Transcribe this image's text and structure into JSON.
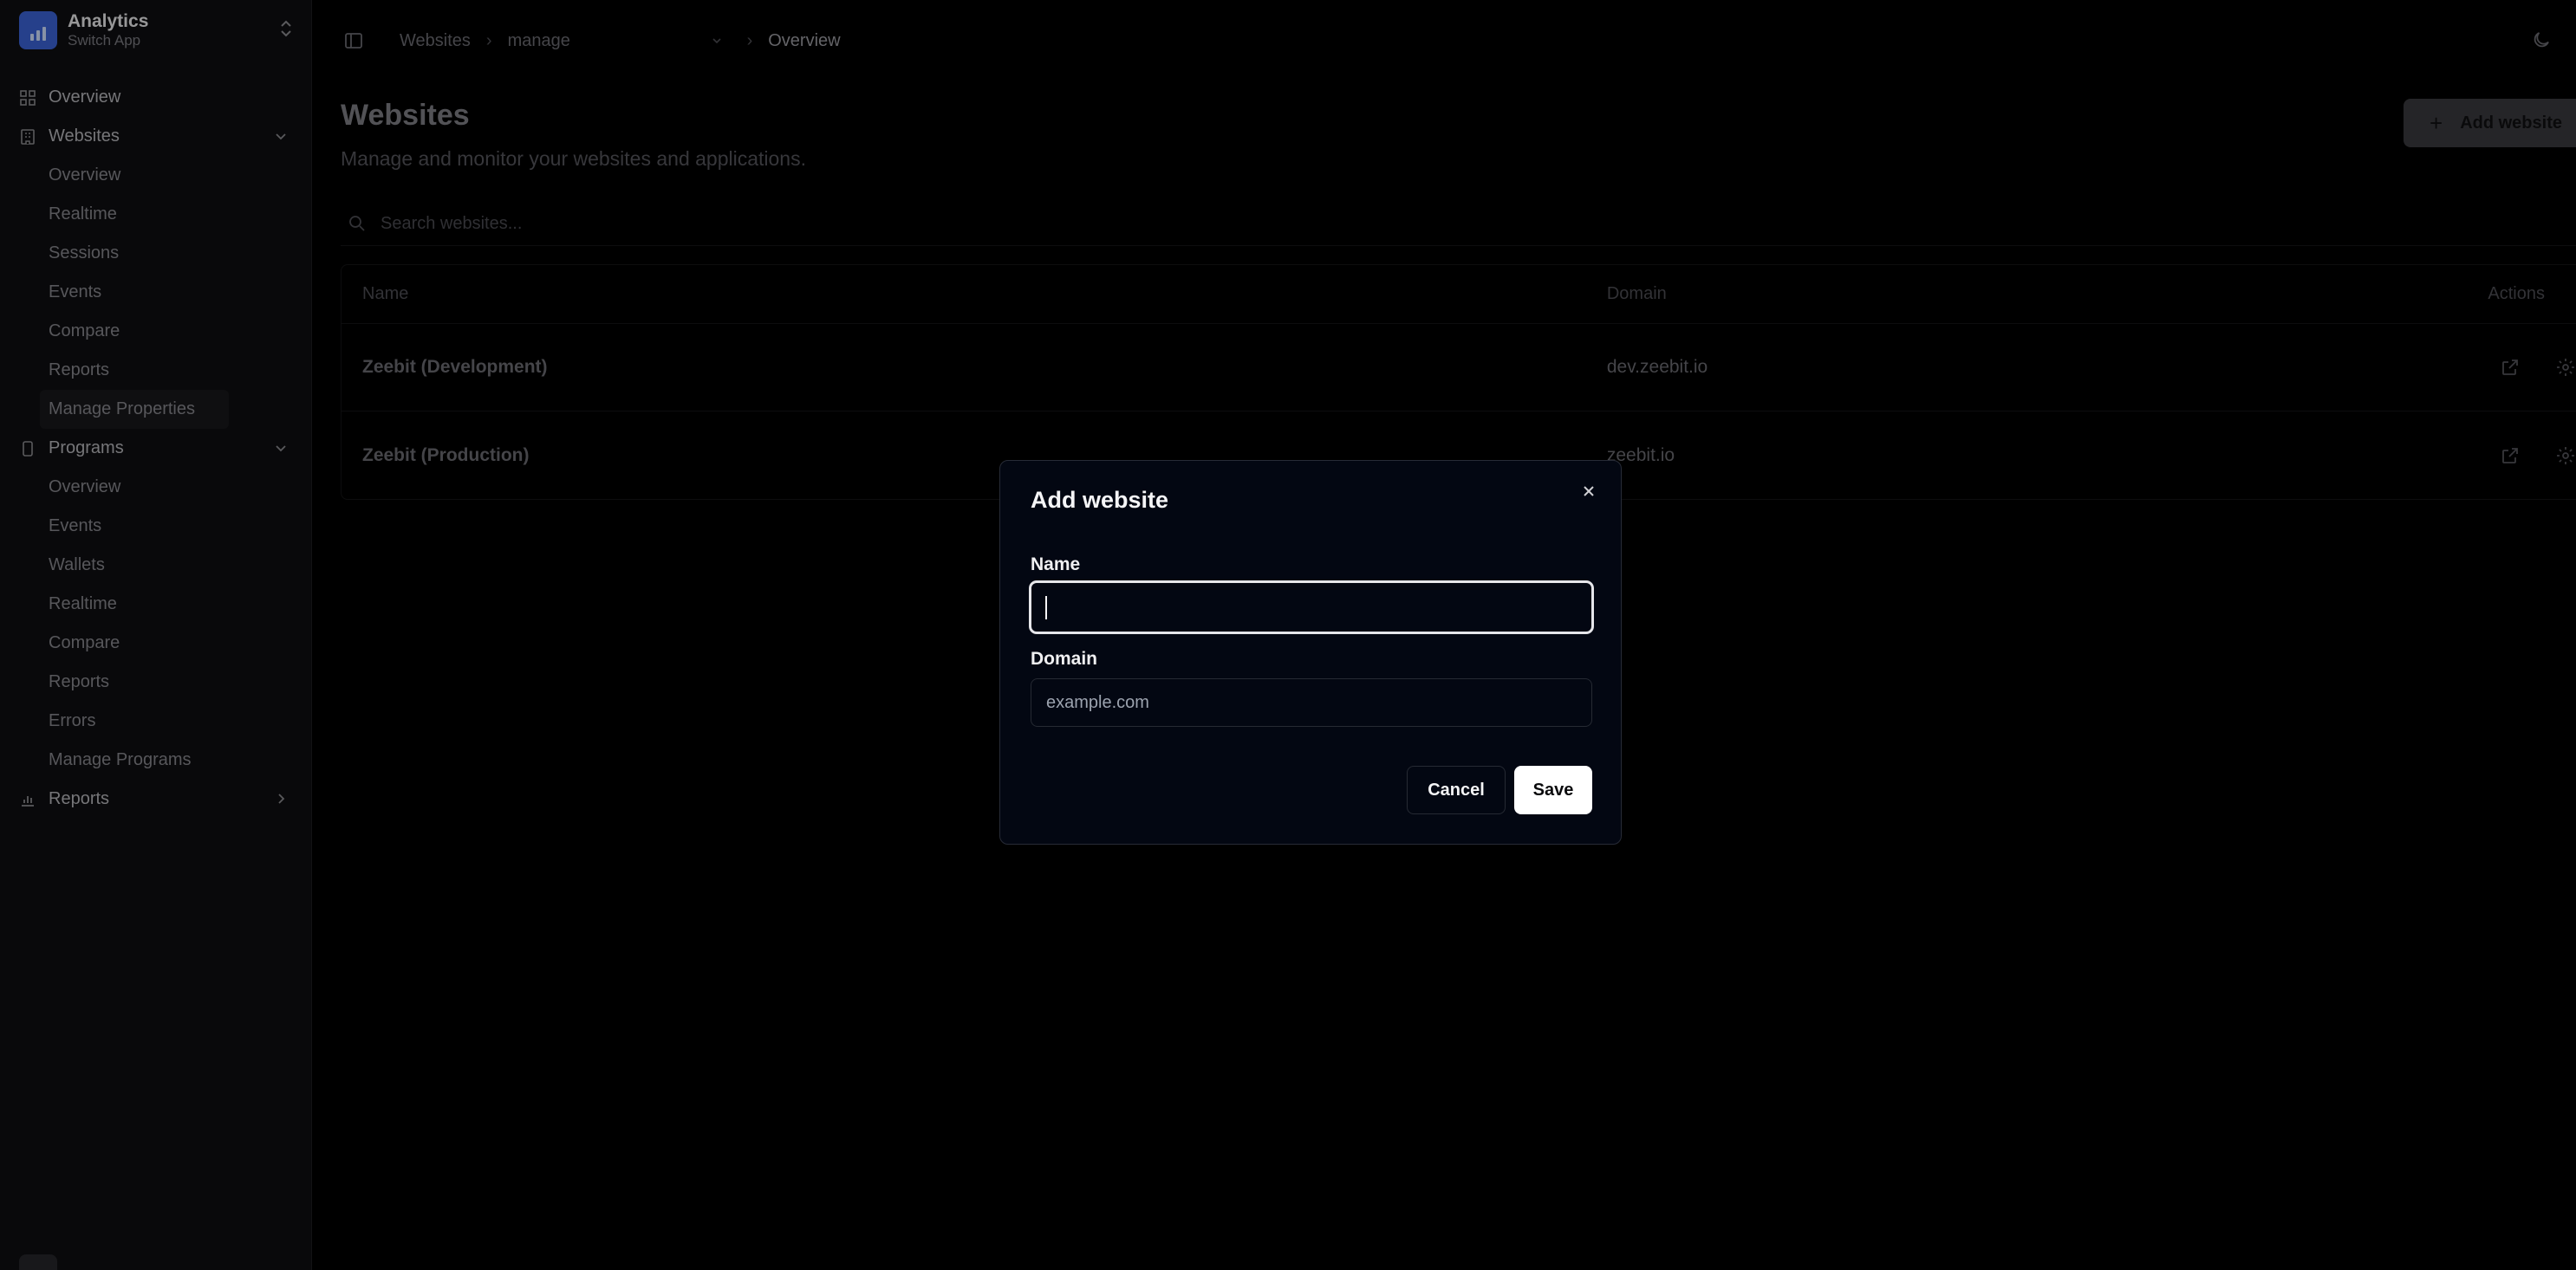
{
  "sidebar": {
    "brand": {
      "title": "Analytics",
      "subtitle": "Switch App"
    },
    "overview": "Overview",
    "websites": {
      "label": "Websites",
      "items": [
        "Overview",
        "Realtime",
        "Sessions",
        "Events",
        "Compare",
        "Reports",
        "Manage Properties"
      ]
    },
    "programs": {
      "label": "Programs",
      "items": [
        "Overview",
        "Events",
        "Wallets",
        "Realtime",
        "Compare",
        "Reports",
        "Errors",
        "Manage Programs"
      ]
    },
    "reports": "Reports"
  },
  "breadcrumb": {
    "root": "Websites",
    "selector": "manage",
    "current": "Overview"
  },
  "page": {
    "title": "Websites",
    "subtitle": "Manage and monitor your websites and applications.",
    "add_button": "Add website"
  },
  "search": {
    "placeholder": "Search websites..."
  },
  "table": {
    "headers": {
      "name": "Name",
      "domain": "Domain",
      "actions": "Actions"
    },
    "rows": [
      {
        "name": "Zeebit (Development)",
        "domain": "dev.zeebit.io"
      },
      {
        "name": "Zeebit (Production)",
        "domain": "zeebit.io"
      }
    ]
  },
  "dialog": {
    "title": "Add website",
    "name_label": "Name",
    "name_value": "",
    "domain_label": "Domain",
    "domain_placeholder": "example.com",
    "cancel": "Cancel",
    "save": "Save"
  },
  "colors": {
    "background": "#000000",
    "dialog_bg": "#030712",
    "brand": "#3b63d6",
    "primary_button": "#ffffff"
  },
  "icons": [
    "layout-grid-icon",
    "building-icon",
    "chevron-down-icon",
    "smartphone-icon",
    "bar-chart-icon",
    "chevron-right-icon",
    "sidebar-toggle-icon",
    "moon-icon",
    "search-icon",
    "external-link-icon",
    "gear-icon",
    "close-icon",
    "plus-icon",
    "chevrons-up-down-icon"
  ]
}
